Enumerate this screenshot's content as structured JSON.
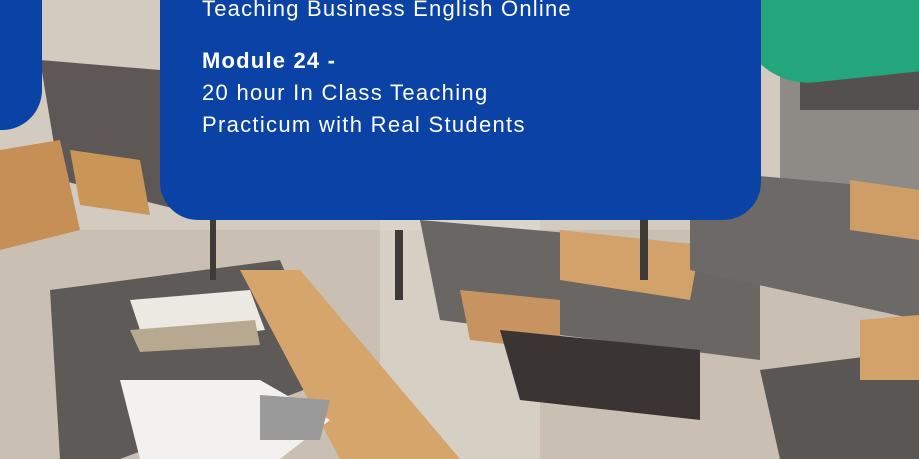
{
  "slide": {
    "previous_title": "Teaching Business English Online",
    "module_heading": "Module 24 -",
    "module_lines": [
      "20 hour In Class Teaching",
      "Practicum with Real Students"
    ]
  },
  "colors": {
    "brand_blue": "#0a43a5",
    "accent_teal": "#23a67c",
    "text_white": "#ffffff"
  },
  "background_image": "classroom-desks-photo"
}
